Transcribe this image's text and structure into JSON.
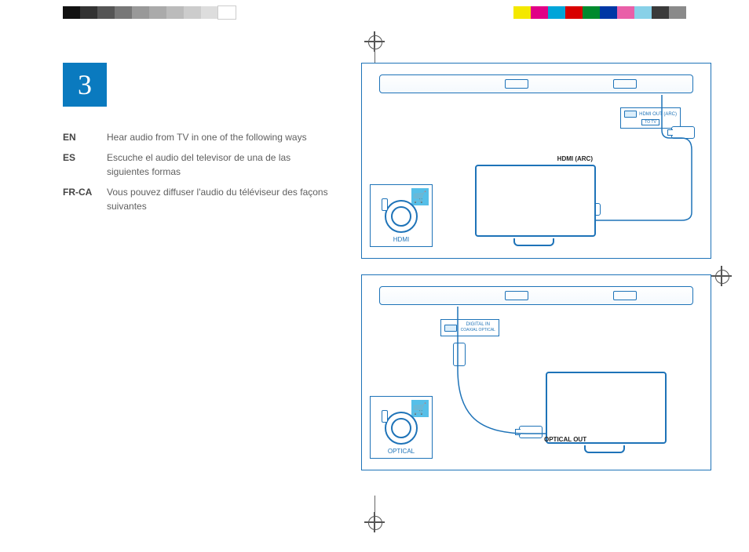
{
  "step_number": "3",
  "instructions": {
    "en": {
      "code": "EN",
      "text": "Hear audio from TV in one of the following ways"
    },
    "es": {
      "code": "ES",
      "text": "Escuche el audio del televisor de una de las siguientes formas"
    },
    "frca": {
      "code": "FR-CA",
      "text": "Vous pouvez diffuser l'audio du téléviseur des façons suivantes"
    }
  },
  "diagram1": {
    "accessory_label": "HDMI",
    "port_line1": "HDMI OUT (ARC)",
    "port_line2": "TO TV",
    "conn_label": "HDMI (ARC)"
  },
  "diagram2": {
    "accessory_label": "OPTICAL",
    "port_line1": "DIGITAL IN",
    "port_line2": "COAXIAL    OPTICAL",
    "conn_label": "OPTICAL OUT"
  },
  "colorbar_left": [
    "#111",
    "#333",
    "#555",
    "#777",
    "#999",
    "#aaa",
    "#bbb",
    "#ccc",
    "#ddd",
    "#fff"
  ],
  "colorbar_right": [
    "#f4e800",
    "#e10086",
    "#00a5d9",
    "#d80000",
    "#008a2e",
    "#0037a5",
    "#e95fa8",
    "#88d1e8",
    "#3a3a3a",
    "#8a8a8a"
  ],
  "icons": {
    "cart": "🛒"
  }
}
